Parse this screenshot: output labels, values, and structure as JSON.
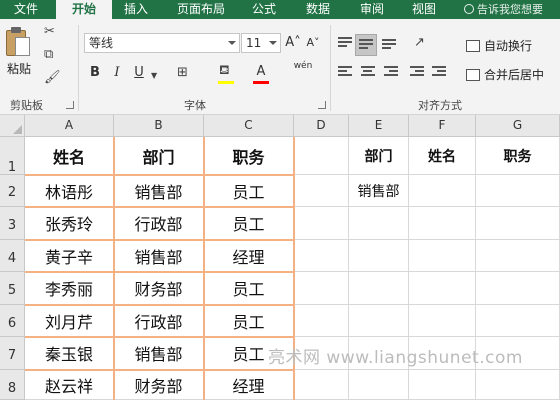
{
  "tabs": [
    "文件",
    "开始",
    "插入",
    "页面布局",
    "公式",
    "数据",
    "审阅",
    "视图"
  ],
  "active_tab": "开始",
  "tell_me": "告诉我您想要",
  "ribbon": {
    "clipboard": {
      "label": "剪贴板",
      "paste": "粘贴"
    },
    "font": {
      "label": "字体",
      "name": "等线",
      "size": "11",
      "grow": "A˄",
      "shrink": "A˅",
      "bold": "B",
      "italic": "I",
      "underline": "U",
      "phonetic": "wén",
      "highlight_color": "#ffff00",
      "font_color": "#ff0000"
    },
    "alignment": {
      "label": "对齐方式",
      "wrap_text": "自动换行",
      "merge_center": "合并后居中"
    }
  },
  "grid": {
    "columns": [
      "A",
      "B",
      "C",
      "D",
      "E",
      "F",
      "G"
    ],
    "rows": [
      "1",
      "2",
      "3",
      "4",
      "5",
      "6",
      "7",
      "8"
    ],
    "table_headers": [
      "姓名",
      "部门",
      "职务"
    ],
    "table_rows": [
      [
        "林语彤",
        "销售部",
        "员工"
      ],
      [
        "张秀玲",
        "行政部",
        "员工"
      ],
      [
        "黄子辛",
        "销售部",
        "经理"
      ],
      [
        "李秀丽",
        "财务部",
        "员工"
      ],
      [
        "刘月芹",
        "行政部",
        "员工"
      ],
      [
        "秦玉银",
        "销售部",
        "员工"
      ],
      [
        "赵云祥",
        "财务部",
        "经理"
      ]
    ],
    "criteria_headers": [
      "部门",
      "姓名",
      "职务"
    ],
    "criteria_value": "销售部"
  },
  "watermark": "亮术网 www.liangshunet.com",
  "colors": {
    "accent": "#217346",
    "table_border": "#f4b183"
  }
}
